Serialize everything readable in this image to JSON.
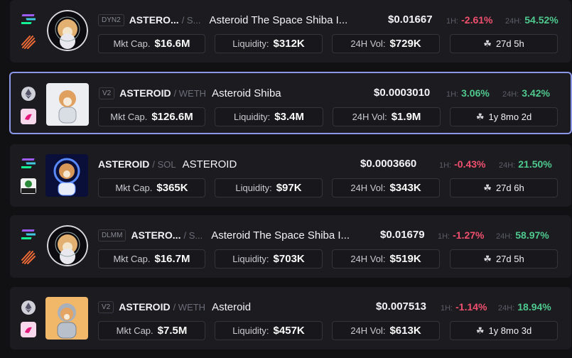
{
  "labels": {
    "mkt_cap": "Mkt Cap.",
    "liquidity": "Liquidity:",
    "volume": "24H Vol:",
    "h1": "1H:",
    "h24": "24H:"
  },
  "colors": {
    "negative": "#f0506e",
    "positive": "#4fc98e",
    "selected_border": "#8b98e8"
  },
  "rows": [
    {
      "chain_icon": "solana-icon",
      "dex_icon": "meteora-icon",
      "badge": "DYN2",
      "base": "ASTERO...",
      "quote": "/ S...",
      "name": "Asteroid The Space Shiba I...",
      "price": "$0.01667",
      "h1": "-2.61%",
      "h24": "54.52%",
      "mkt_cap": "$16.6M",
      "liquidity": "$312K",
      "volume": "$729K",
      "age": "27d 5h"
    },
    {
      "chain_icon": "ethereum-icon",
      "dex_icon": "uniswap-icon",
      "badge": "V2",
      "base": "ASTEROID",
      "quote": "/ WETH",
      "name": "Asteroid Shiba",
      "price": "$0.0003010",
      "h1": "3.06%",
      "h24": "3.42%",
      "mkt_cap": "$126.6M",
      "liquidity": "$3.4M",
      "volume": "$1.9M",
      "age": "1y 8mo 2d"
    },
    {
      "chain_icon": "solana-icon",
      "dex_icon": "swap-icon",
      "badge": "",
      "base": "ASTEROID",
      "quote": "/ SOL",
      "name": "ASTEROID",
      "price": "$0.0003660",
      "h1": "-0.43%",
      "h24": "21.50%",
      "mkt_cap": "$365K",
      "liquidity": "$97K",
      "volume": "$343K",
      "age": "27d 6h"
    },
    {
      "chain_icon": "solana-icon",
      "dex_icon": "meteora-icon",
      "badge": "DLMM",
      "base": "ASTERO...",
      "quote": "/ S...",
      "name": "Asteroid The Space Shiba I...",
      "price": "$0.01679",
      "h1": "-1.27%",
      "h24": "58.97%",
      "mkt_cap": "$16.7M",
      "liquidity": "$703K",
      "volume": "$519K",
      "age": "27d 5h"
    },
    {
      "chain_icon": "ethereum-icon",
      "dex_icon": "uniswap-icon",
      "badge": "V2",
      "base": "ASTEROID",
      "quote": "/ WETH",
      "name": "Asteroid",
      "price": "$0.007513",
      "h1": "-1.14%",
      "h24": "18.94%",
      "mkt_cap": "$7.5M",
      "liquidity": "$457K",
      "volume": "$613K",
      "age": "1y 8mo 3d"
    }
  ]
}
